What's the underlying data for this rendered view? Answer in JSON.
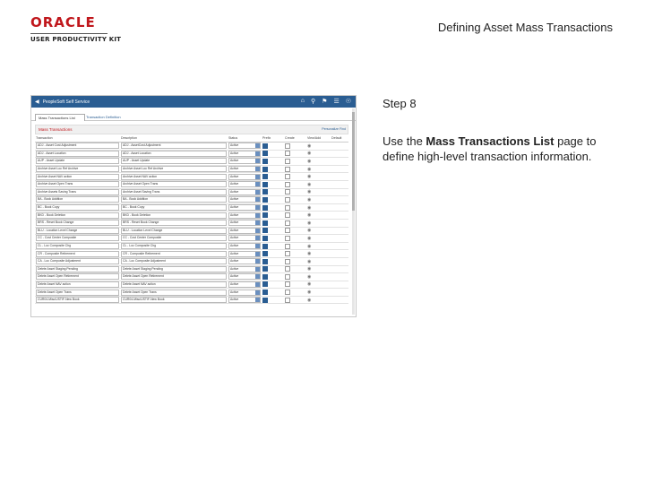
{
  "logo": {
    "brand": "ORACLE",
    "subtitle": "USER PRODUCTIVITY KIT"
  },
  "page_title": "Defining Asset Mass Transactions",
  "step": "Step 8",
  "instruction": {
    "pre": "Use the ",
    "bold": "Mass Transactions List",
    "post": " page to define high-level transaction information."
  },
  "screenshot": {
    "app_title": "PeopleSoft Self Service",
    "tabs": [
      "Mass Transactions List",
      "Transaction Definition"
    ],
    "grid_title": "Mass Transactions",
    "grid_links": "Personalize  Find",
    "columns": [
      "Transaction",
      "Description",
      "Status",
      "Prefix",
      "Create",
      "View/Add",
      "Default"
    ],
    "rows": [
      {
        "code": "ADJ - Asset Cost Adjustment",
        "desc": "ADJ - AssetCost Adjustment",
        "status": "Active",
        "prefix": true
      },
      {
        "code": "ADJ - Asset Location",
        "desc": "ADJ - Asset Location",
        "status": "Active",
        "prefix": true
      },
      {
        "code": "AUP - Asset Update",
        "desc": "AUP - Asset Update",
        "status": "Active",
        "prefix": true
      },
      {
        "code": "Archive Asset Loc Ref Archive",
        "desc": "Archive Asset Loc Ref Archive",
        "status": "Active",
        "prefix": true
      },
      {
        "code": "Archive Asset NAV action",
        "desc": "Archive Asset NAV action",
        "status": "Active",
        "prefix": true
      },
      {
        "code": "Archive Asset Open Trans",
        "desc": "Archive Asset Open Trans",
        "status": "Active",
        "prefix": true
      },
      {
        "code": "Archive Assets Saving Trans",
        "desc": "Archive Asset Saving Trans",
        "status": "Active",
        "prefix": true
      },
      {
        "code": "BA - Book Addition",
        "desc": "BA - Book Addition",
        "status": "Active",
        "prefix": true
      },
      {
        "code": "BC - Book Copy",
        "desc": "BC - Book Copy",
        "status": "Active",
        "prefix": true
      },
      {
        "code": "BKD - Book Deletion",
        "desc": "BKD - Book Deletion",
        "status": "Active",
        "prefix": true
      },
      {
        "code": "BRS - Reset Book Change",
        "desc": "BRS - Reset Book Change",
        "status": "Active",
        "prefix": true
      },
      {
        "code": "BLU - Location Level Change",
        "desc": "BLU - Location Level Change",
        "status": "Active",
        "prefix": true
      },
      {
        "code": "CC - Cost Center Composite",
        "desc": "CC - Cost Center Composite",
        "status": "Active",
        "prefix": true
      },
      {
        "code": "CL - Loc Composite Chg",
        "desc": "CL - Loc Composite Chg",
        "status": "Active",
        "prefix": true
      },
      {
        "code": "CR - Composite Retirement",
        "desc": "CR - Composite Retirement",
        "status": "Active",
        "prefix": true
      },
      {
        "code": "CA - Loc Composite Adjustment",
        "desc": "CA - Loc Composite Adjustment",
        "status": "Active",
        "prefix": true
      },
      {
        "code": "Delete Asset Staging Pending",
        "desc": "Delete Asset Staging Pending",
        "status": "Active",
        "prefix": true
      },
      {
        "code": "Delete Asset Open Retirement",
        "desc": "Delete Asset Open Retirement",
        "status": "Active",
        "prefix": true
      },
      {
        "code": "Delete Asset NAV action",
        "desc": "Delete Asset NAV action",
        "status": "Active",
        "prefix": true
      },
      {
        "code": "Delete Asset Open Trans",
        "desc": "Delete Asset Open Trans",
        "status": "Active",
        "prefix": true
      },
      {
        "code": "CUR04-Misc/USTIF-New Book",
        "desc": "CUR04-Misc/USTIF-New Book",
        "status": "Active",
        "prefix": true
      }
    ]
  }
}
